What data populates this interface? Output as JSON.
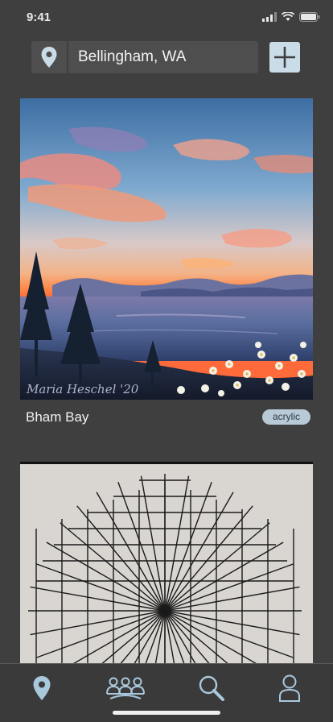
{
  "status": {
    "time": "9:41"
  },
  "location": {
    "value": "Bellingham, WA"
  },
  "icons": {
    "pin": "location-pin-icon",
    "add": "plus-icon",
    "tabs": [
      "location-pin-icon",
      "group-icon",
      "search-icon",
      "user-icon"
    ]
  },
  "feed": [
    {
      "title": "Bham Bay",
      "tag": "acrylic",
      "signature": "Maria Heschel '20"
    },
    {
      "title": "",
      "tag": ""
    }
  ],
  "colors": {
    "background": "#3f3f3f",
    "accent": "#c9dce8",
    "tab_icon": "#a9c8dc",
    "badge": "#b8cad6"
  }
}
